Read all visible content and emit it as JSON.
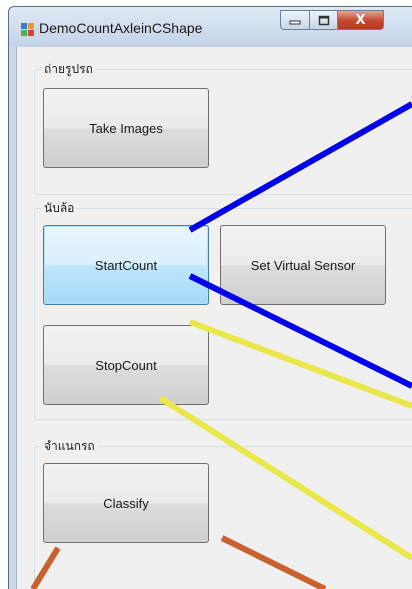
{
  "window": {
    "title": "DemoCountAxleinCShape",
    "close_glyph": "X"
  },
  "groups": {
    "capture": {
      "label": "ถ่ายรูปรถ",
      "take_images_label": "Take Images"
    },
    "count": {
      "label": "นับล้อ",
      "start_count_label": "StartCount",
      "set_virtual_sensor_label": "Set Virtual Sensor",
      "stop_count_label": "StopCount"
    },
    "classify": {
      "label": "จำแนกรถ",
      "classify_label": "Classify"
    }
  },
  "colors": {
    "line_blue": "#0000ee",
    "line_yellow": "#e8e84a",
    "line_orange": "#c8612e",
    "focus_border": "#3c7fb1"
  },
  "icons": {
    "app": "app-form-icon",
    "minimize": "minimize-icon",
    "maximize": "maximize-icon",
    "close": "close-icon"
  }
}
